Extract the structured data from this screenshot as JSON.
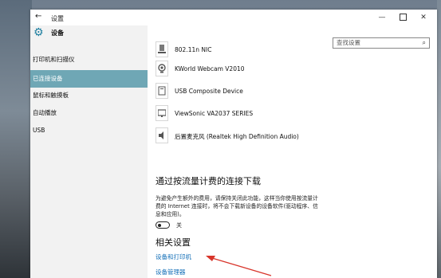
{
  "window": {
    "title": "设置"
  },
  "title_bar": {
    "back_icon": "←",
    "minimize": "—",
    "close": "✕"
  },
  "sidebar": {
    "header": "设备",
    "items": [
      {
        "label": "打印机和扫描仪",
        "active": false
      },
      {
        "label": "已连接设备",
        "active": true
      },
      {
        "label": "鼠标和触摸板",
        "active": false
      },
      {
        "label": "自动播放",
        "active": false
      },
      {
        "label": "USB",
        "active": false
      }
    ]
  },
  "search": {
    "placeholder": "查找设置"
  },
  "devices": [
    {
      "name": "802.11n NIC",
      "icon": "usb-icon"
    },
    {
      "name": "KWorld Webcam V2010",
      "icon": "webcam-icon"
    },
    {
      "name": "USB Composite Device",
      "icon": "device-icon"
    },
    {
      "name": "ViewSonic VA2037 SERIES",
      "icon": "monitor-icon"
    },
    {
      "name": "后置麦克风 (Realtek High Definition Audio)",
      "icon": "speaker-icon"
    }
  ],
  "metered": {
    "title": "通过按流量计费的连接下载",
    "desc": "为避免产生额外的费用，请保持关闭此功能，这样当你使用按流量计费的 Internet 连接时，将不会下载新设备的设备软件(驱动程序、信息和应用)。",
    "toggle_state": "关"
  },
  "related": {
    "title": "相关设置",
    "links": [
      "设备和打印机",
      "设备管理器"
    ]
  },
  "colors": {
    "accent": "#6fa7b5",
    "link": "#1570b8",
    "annotation": "#d8342a"
  }
}
